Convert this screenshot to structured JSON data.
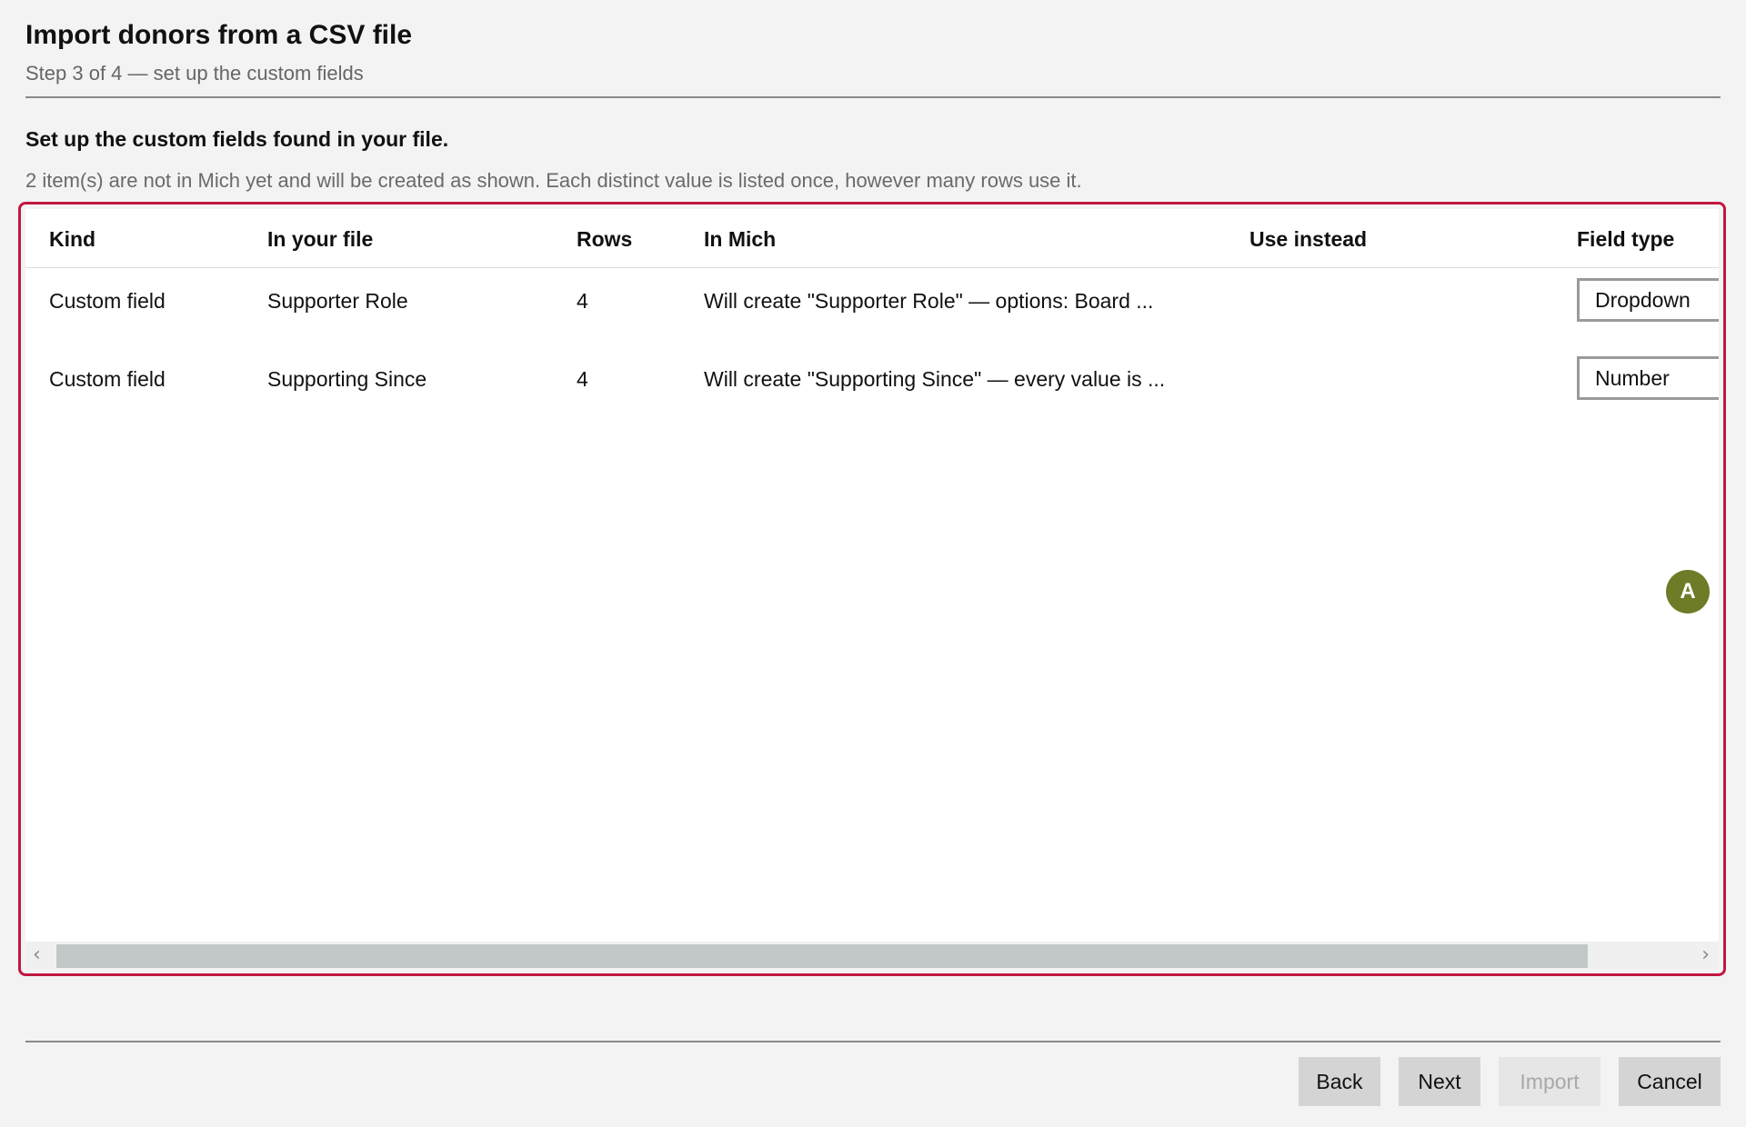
{
  "header": {
    "title": "Import donors from a CSV file",
    "subtitle": "Step 3 of 4 — set up the custom fields"
  },
  "section": {
    "title": "Set up the custom fields found in your file.",
    "description": "2 item(s) are not in Mich yet and will be created as shown. Each distinct value is listed once, however many rows use it."
  },
  "grid": {
    "columns": {
      "kind": "Kind",
      "in_file": "In your file",
      "rows": "Rows",
      "in_mich": "In Mich",
      "use_instead": "Use instead",
      "field_type": "Field type"
    },
    "rows": [
      {
        "kind": "Custom field",
        "in_file": "Supporter Role",
        "rows": "4",
        "in_mich": "Will create \"Supporter Role\" — options: Board ...",
        "use_instead": "",
        "field_type": "Dropdown"
      },
      {
        "kind": "Custom field",
        "in_file": "Supporting Since",
        "rows": "4",
        "in_mich": "Will create \"Supporting Since\" — every value is ...",
        "use_instead": "",
        "field_type": "Number"
      }
    ],
    "scrollbar": {
      "left_arrow": "‹",
      "right_arrow": "›",
      "position": 0.0
    }
  },
  "annotation": {
    "marker_label": "A",
    "highlight_color": "#c2183f",
    "marker_color": "#6e7b27"
  },
  "footer": {
    "back": "Back",
    "next": "Next",
    "import": "Import",
    "cancel": "Cancel"
  }
}
